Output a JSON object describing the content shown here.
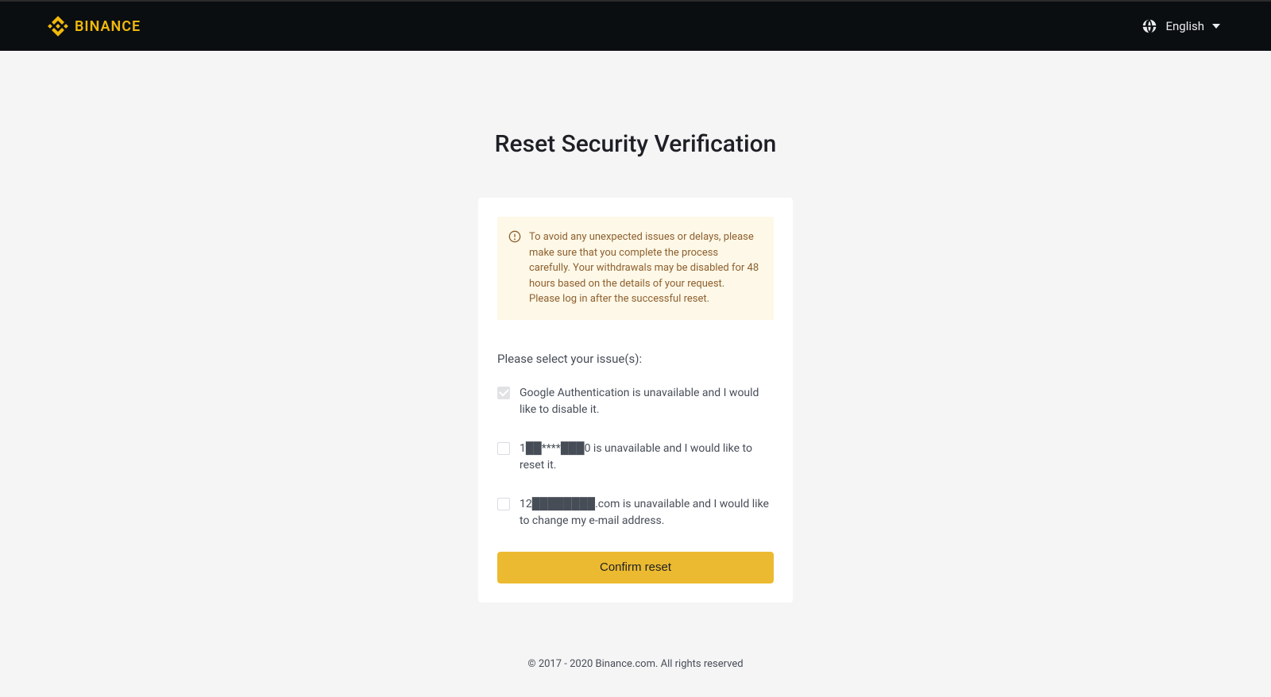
{
  "header": {
    "brand": "BINANCE",
    "language": "English"
  },
  "page": {
    "title": "Reset Security Verification"
  },
  "warning": {
    "line1": "To avoid any unexpected issues or delays, please make sure that you complete the process carefully. Your withdrawals may be disabled for 48 hours based on the details of your request.",
    "line2": "Please log in after the successful reset."
  },
  "form": {
    "prompt": "Please select your issue(s):",
    "issues": [
      {
        "label": "Google Authentication is unavailable and I would like to disable it.",
        "checked": true
      },
      {
        "label": "1██****███0 is unavailable and I would like to reset it.",
        "checked": false
      },
      {
        "label": "12████████.com is unavailable and I would like to change my e-mail address.",
        "checked": false
      }
    ],
    "confirm_label": "Confirm reset"
  },
  "footer": {
    "copyright": "© 2017 - 2020 Binance.com. All rights reserved"
  }
}
